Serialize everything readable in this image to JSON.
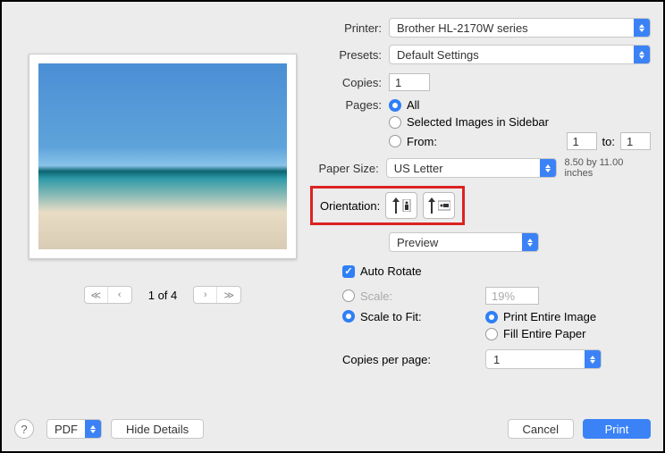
{
  "labels": {
    "printer": "Printer:",
    "presets": "Presets:",
    "copies": "Copies:",
    "pages": "Pages:",
    "all": "All",
    "selectedImages": "Selected Images in Sidebar",
    "from": "From:",
    "to": "to:",
    "paperSize": "Paper Size:",
    "paperDim": "8.50 by 11.00 inches",
    "orientation": "Orientation:",
    "autoRotate": "Auto Rotate",
    "scale": "Scale:",
    "scaleToFit": "Scale to Fit:",
    "printEntire": "Print Entire Image",
    "fillEntire": "Fill Entire Paper",
    "copiesPerPage": "Copies per page:",
    "pdf": "PDF",
    "hideDetails": "Hide Details",
    "cancel": "Cancel",
    "print": "Print",
    "help": "?"
  },
  "values": {
    "printer": "Brother HL-2170W series",
    "presets": "Default Settings",
    "copies": "1",
    "fromPage": "1",
    "toPage": "1",
    "paperSize": "US Letter",
    "section": "Preview",
    "scalePct": "19%",
    "copiesPerPage": "1",
    "pageIndicator": "1 of 4"
  }
}
